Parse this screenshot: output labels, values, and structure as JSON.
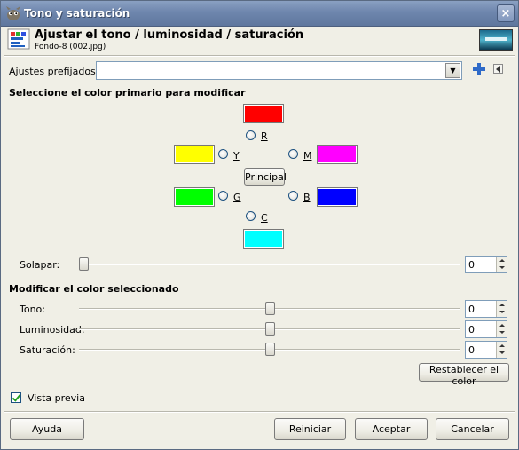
{
  "window": {
    "title": "Tono y saturación",
    "close_glyph": "×"
  },
  "header": {
    "title": "Ajustar el tono / luminosidad / saturación",
    "subtitle": "Fondo-8 (002.jpg)"
  },
  "presets": {
    "label": "Ajustes prefijados:",
    "value": "",
    "dropdown_glyph": "▼"
  },
  "primary_section": {
    "title": "Seleccione el color primario para modificar",
    "colors": [
      {
        "key": "R",
        "label": "R",
        "color": "#ff0000"
      },
      {
        "key": "Y",
        "label": "Y",
        "color": "#ffff00"
      },
      {
        "key": "M",
        "label": "M",
        "color": "#ff00ff"
      },
      {
        "key": "G",
        "label": "G",
        "color": "#00ff00"
      },
      {
        "key": "B",
        "label": "B",
        "color": "#0000ff"
      },
      {
        "key": "C",
        "label": "C",
        "color": "#00ffff"
      }
    ],
    "master_button": "Principal"
  },
  "overlap": {
    "label": "Solapar:",
    "value": "0",
    "level": 0
  },
  "modify_section": {
    "title": "Modificar el color seleccionado",
    "hue": {
      "label": "Tono:",
      "value": "0",
      "level": 0.5
    },
    "lightness": {
      "label": "Luminosidad:",
      "value": "0",
      "level": 0.5
    },
    "saturation": {
      "label": "Saturación:",
      "value": "0",
      "level": 0.5
    },
    "reset_color_button": "Restablecer el color"
  },
  "preview": {
    "label": "Vista previa",
    "checked": true
  },
  "buttons": {
    "help": "Ayuda",
    "reset": "Reiniciar",
    "ok": "Aceptar",
    "cancel": "Cancelar"
  },
  "icons": {
    "app": "gimp-icon",
    "dialog": "hue-saturation-icon",
    "add_preset": "plus-icon",
    "preset_menu": "triangle-left-icon"
  }
}
